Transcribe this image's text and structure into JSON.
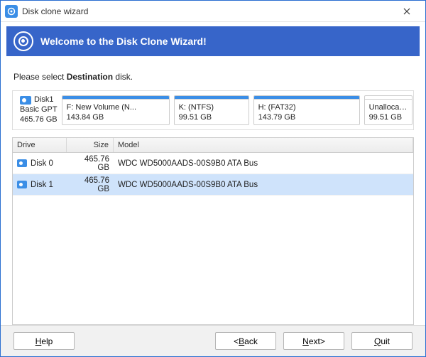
{
  "window": {
    "title": "Disk clone wizard",
    "close_icon": "close-icon"
  },
  "banner": {
    "title": "Welcome to the Disk Clone Wizard!"
  },
  "instruction": {
    "prefix": "Please select ",
    "bold": "Destination",
    "suffix": " disk."
  },
  "disk_summary": {
    "name": "Disk1",
    "type": "Basic GPT",
    "size": "465.76 GB"
  },
  "partitions": [
    {
      "label": "F: New Volume (N...",
      "size": "143.84 GB",
      "hasbar": true
    },
    {
      "label": "K: (NTFS)",
      "size": "99.51 GB",
      "hasbar": true
    },
    {
      "label": "H: (FAT32)",
      "size": "143.79 GB",
      "hasbar": true
    },
    {
      "label": "Unallocated",
      "size": "99.51 GB",
      "hasbar": false
    }
  ],
  "table": {
    "headers": {
      "drive": "Drive",
      "size": "Size",
      "model": "Model"
    },
    "rows": [
      {
        "drive": "Disk 0",
        "size": "465.76 GB",
        "model": "WDC WD5000AADS-00S9B0 ATA Bus",
        "selected": false
      },
      {
        "drive": "Disk 1",
        "size": "465.76 GB",
        "model": "WDC WD5000AADS-00S9B0 ATA Bus",
        "selected": true
      }
    ]
  },
  "footer": {
    "help": {
      "pre": "",
      "m": "H",
      "post": "elp"
    },
    "back": {
      "pre": "<",
      "m": "B",
      "post": "ack"
    },
    "next": {
      "pre": "",
      "m": "N",
      "post": "ext>"
    },
    "quit": {
      "pre": "",
      "m": "Q",
      "post": "uit"
    }
  }
}
